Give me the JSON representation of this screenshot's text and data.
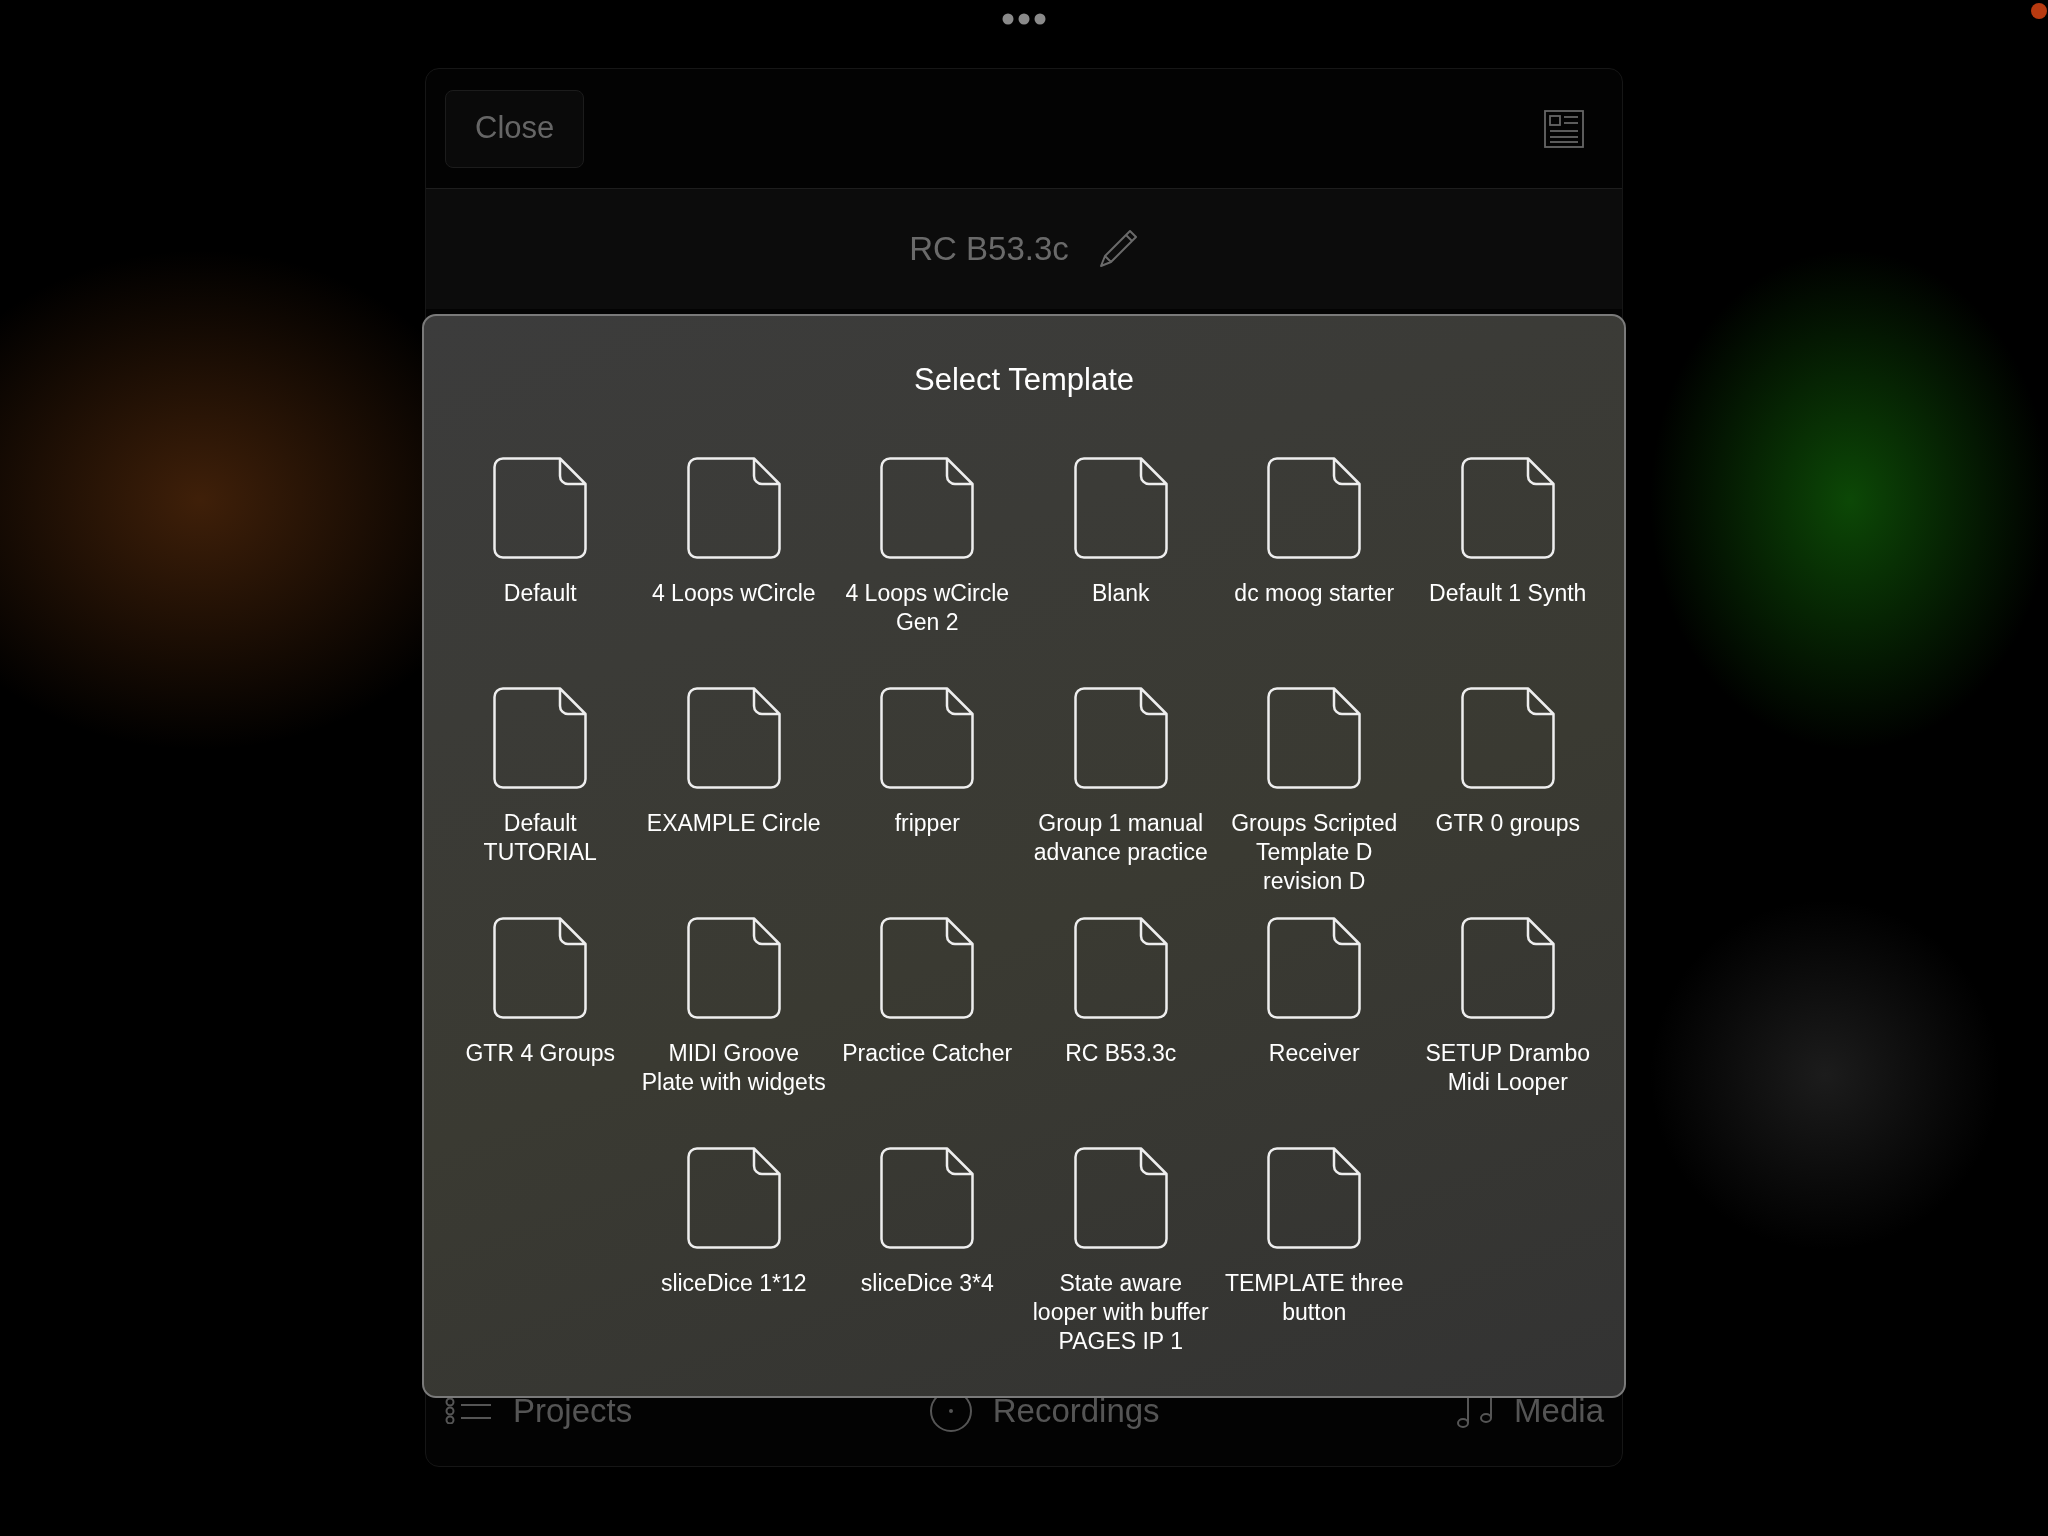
{
  "header": {
    "close_button": "Close"
  },
  "project": {
    "title": "RC B53.3c"
  },
  "dialog": {
    "title": "Select Template",
    "templates": [
      {
        "name": "Default"
      },
      {
        "name": "4 Loops wCircle"
      },
      {
        "name": "4 Loops wCircle Gen 2"
      },
      {
        "name": "Blank"
      },
      {
        "name": "dc moog starter"
      },
      {
        "name": "Default 1 Synth"
      },
      {
        "name": "Default TUTORIAL"
      },
      {
        "name": "EXAMPLE Circle"
      },
      {
        "name": "fripper"
      },
      {
        "name": "Group 1 manual advance practice"
      },
      {
        "name": "Groups Scripted Template D revision D"
      },
      {
        "name": "GTR 0 groups"
      },
      {
        "name": "GTR 4 Groups"
      },
      {
        "name": "MIDI Groove Plate with widgets"
      },
      {
        "name": "Practice Catcher"
      },
      {
        "name": "RC B53.3c"
      },
      {
        "name": "Receiver"
      },
      {
        "name": "SETUP Drambo Midi Looper"
      },
      {
        "name": "sliceDice 1*12"
      },
      {
        "name": "sliceDice 3*4"
      },
      {
        "name": "State aware looper with buffer PAGES IP 1"
      },
      {
        "name": "TEMPLATE three button"
      }
    ]
  },
  "tab_bar": [
    {
      "kind": "projects",
      "label": "Projects"
    },
    {
      "kind": "recordings",
      "label": "Recordings"
    },
    {
      "kind": "media",
      "label": "Media"
    }
  ]
}
